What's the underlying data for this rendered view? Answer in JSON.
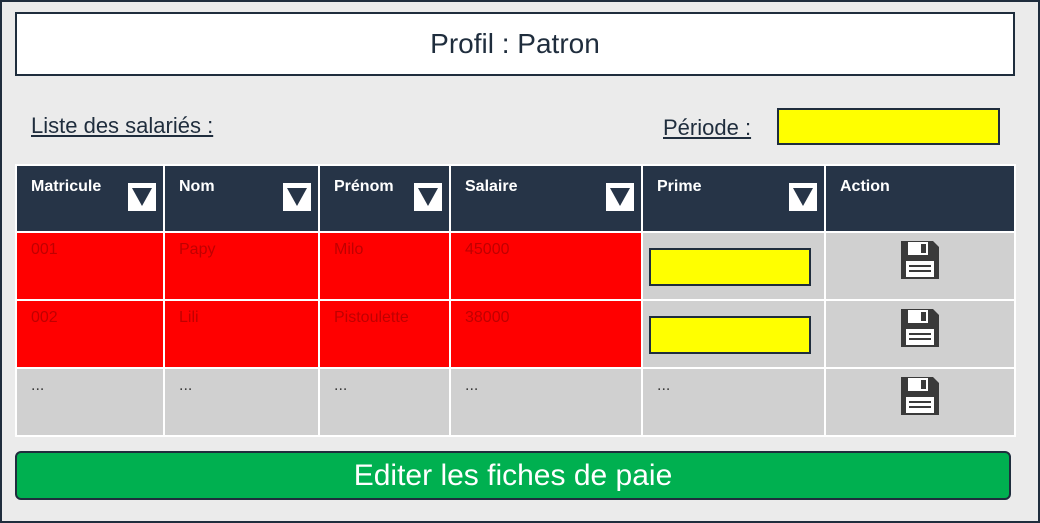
{
  "header": {
    "title": "Profil : Patron"
  },
  "list": {
    "label": "Liste des salariés :"
  },
  "periode": {
    "label": "Période :",
    "value": ""
  },
  "table": {
    "columns": [
      "Matricule",
      "Nom",
      "Prénom",
      "Salaire",
      "Prime",
      "Action"
    ],
    "rows": [
      {
        "matricule": "001",
        "nom": "Papy",
        "prenom": "Milo",
        "salaire": "45000",
        "prime": ""
      },
      {
        "matricule": "002",
        "nom": "Lili",
        "prenom": "Pistoulette",
        "salaire": "38000",
        "prime": ""
      },
      {
        "matricule": "...",
        "nom": "...",
        "prenom": "...",
        "salaire": "...",
        "prime": "..."
      }
    ]
  },
  "footer": {
    "edit_label": "Editer les fiches de paie"
  },
  "colors": {
    "header_bg": "#263447",
    "highlight_row": "#ff0000",
    "input_fill": "#ffff00",
    "button_green": "#00b050"
  },
  "icons": {
    "sort": "chevron-down-icon",
    "save": "floppy-disk-icon"
  }
}
